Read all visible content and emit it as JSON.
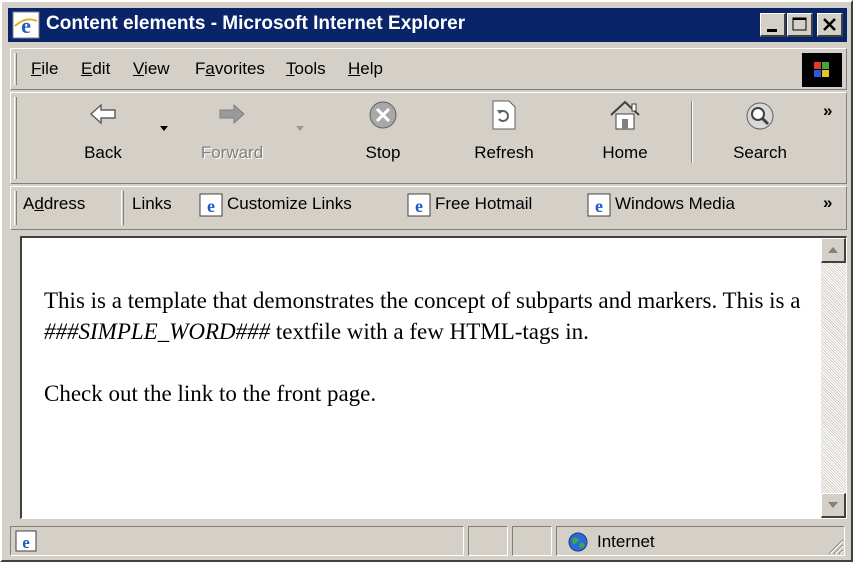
{
  "window": {
    "title": "Content elements - Microsoft Internet Explorer"
  },
  "menu": {
    "items": [
      {
        "label": "File",
        "accel": "F",
        "rest": "ile"
      },
      {
        "label": "Edit",
        "accel": "E",
        "rest": "dit"
      },
      {
        "label": "View",
        "accel": "V",
        "rest": "iew"
      },
      {
        "label": "Favorites",
        "accel": "a",
        "pre": "F",
        "rest": "vorites"
      },
      {
        "label": "Tools",
        "accel": "T",
        "rest": "ools"
      },
      {
        "label": "Help",
        "accel": "H",
        "rest": "elp"
      }
    ]
  },
  "toolbar": {
    "back": "Back",
    "forward": "Forward",
    "stop": "Stop",
    "refresh": "Refresh",
    "home": "Home",
    "search": "Search",
    "more": "»"
  },
  "address_bar": {
    "address_pre": "A",
    "address_accel": "d",
    "address_rest": "dress",
    "links": "Links",
    "link_items": [
      "Customize Links",
      "Free Hotmail",
      "Windows Media"
    ],
    "more": "»"
  },
  "content": {
    "p1_before": "This is a template that demonstrates the concept of subparts and markers. This is a ",
    "p1_marker": "###SIMPLE_WORD###",
    "p1_after": " textfile with a few HTML-tags in.",
    "p2": "Check out the link to the front page."
  },
  "status": {
    "zone": "Internet"
  },
  "icons": {
    "app": "ie-logo-icon",
    "back": "back-arrow-icon",
    "forward": "forward-arrow-icon",
    "stop": "stop-icon",
    "refresh": "refresh-icon",
    "home": "home-icon",
    "search": "search-icon",
    "zone": "globe-icon"
  },
  "colors": {
    "titlebar": "#0a246a",
    "chrome": "#d4d0c8"
  }
}
